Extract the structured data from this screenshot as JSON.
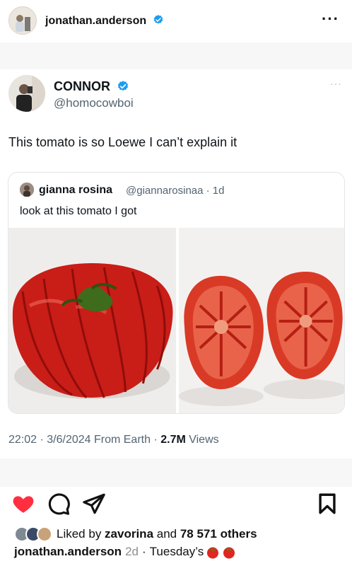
{
  "header": {
    "username": "jonathan.anderson",
    "more_icon": "more-horizontal-icon"
  },
  "tweet": {
    "name": "CONNOR",
    "handle": "@homocowboi",
    "more_icon": "more-horizontal-icon",
    "text": "This tomato is so Loewe I can’t explain it",
    "quote": {
      "name": "gianna rosina",
      "handle_time": "@giannarosinaa · 1d",
      "text": "look at this tomato I got"
    },
    "time_date": "22:02 · 3/6/2024 From Earth · ",
    "views_count": "2.7M",
    "views_label": " Views"
  },
  "actions": {
    "like_icon": "heart-filled-icon",
    "comment_icon": "comment-icon",
    "share_icon": "send-icon",
    "save_icon": "bookmark-icon"
  },
  "likes": {
    "prefix": "Liked by ",
    "user": "zavorina",
    "mid": " and ",
    "others": "78 571 others"
  },
  "caption": {
    "username": "jonathan.anderson",
    "time": "2d",
    "sep": "·",
    "text": "Tuesday’s"
  },
  "colors": {
    "like_red": "#ff2f40",
    "verified_blue": "#1d9bf0",
    "secondary_text": "#536471"
  }
}
